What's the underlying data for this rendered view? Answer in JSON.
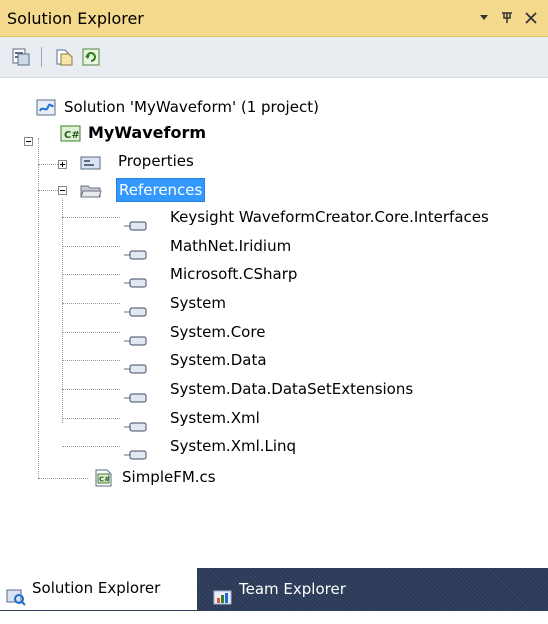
{
  "window": {
    "title": "Solution Explorer",
    "dropdown_glyph": "▾",
    "pin_glyph": "ᵖ",
    "close_glyph": "✕"
  },
  "toolbar": {
    "buttons": [
      {
        "name": "properties-icon"
      },
      {
        "name": "show-all-files-icon"
      },
      {
        "name": "refresh-icon"
      }
    ]
  },
  "tree": {
    "solution": "Solution 'MyWaveform' (1 project)",
    "project": "MyWaveform",
    "properties": "Properties",
    "references": "References",
    "refs": [
      "Keysight WaveformCreator.Core.Interfaces",
      "MathNet.Iridium",
      "Microsoft.CSharp",
      "System",
      "System.Core",
      "System.Data",
      "System.Data.DataSetExtensions",
      "System.Xml",
      "System.Xml.Linq"
    ],
    "file": "SimpleFM.cs"
  },
  "tabs": {
    "active": "Solution Explorer",
    "inactive": "Team Explorer"
  },
  "colors": {
    "titlebar": "#f5d98c",
    "selection": "#3399ff",
    "tabstrip": "#2d3a54"
  }
}
